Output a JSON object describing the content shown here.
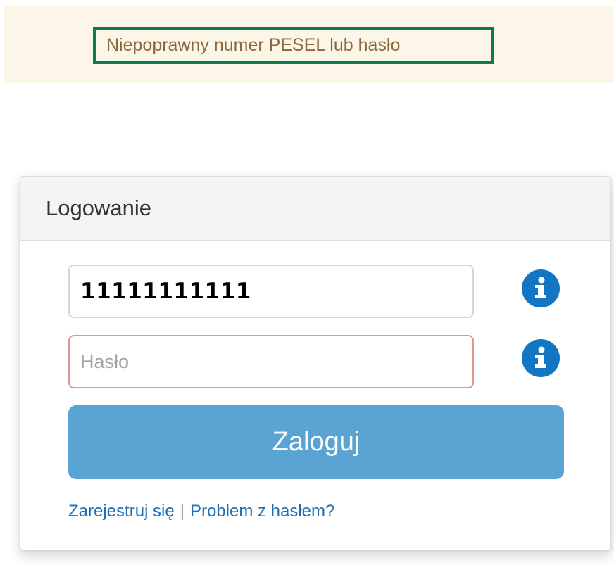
{
  "alert": {
    "message": "Niepoprawny numer PESEL lub hasło"
  },
  "login": {
    "heading": "Logowanie",
    "pesel": {
      "value": "11111111111",
      "info_icon": "info-icon"
    },
    "password": {
      "placeholder": "Hasło",
      "value": "",
      "info_icon": "info-icon"
    },
    "submit_label": "Zaloguj",
    "links": {
      "register": "Zarejestruj się",
      "separator": "|",
      "password_problem": "Problem z hasłem?"
    }
  },
  "colors": {
    "alert_background": "#fcf6e8",
    "alert_border": "#0b7d4e",
    "alert_text": "#8a6a3c",
    "button": "#5aa4d3",
    "info_icon": "#1276c2",
    "link": "#1d6fb8",
    "invalid_field_border": "#e09595"
  }
}
